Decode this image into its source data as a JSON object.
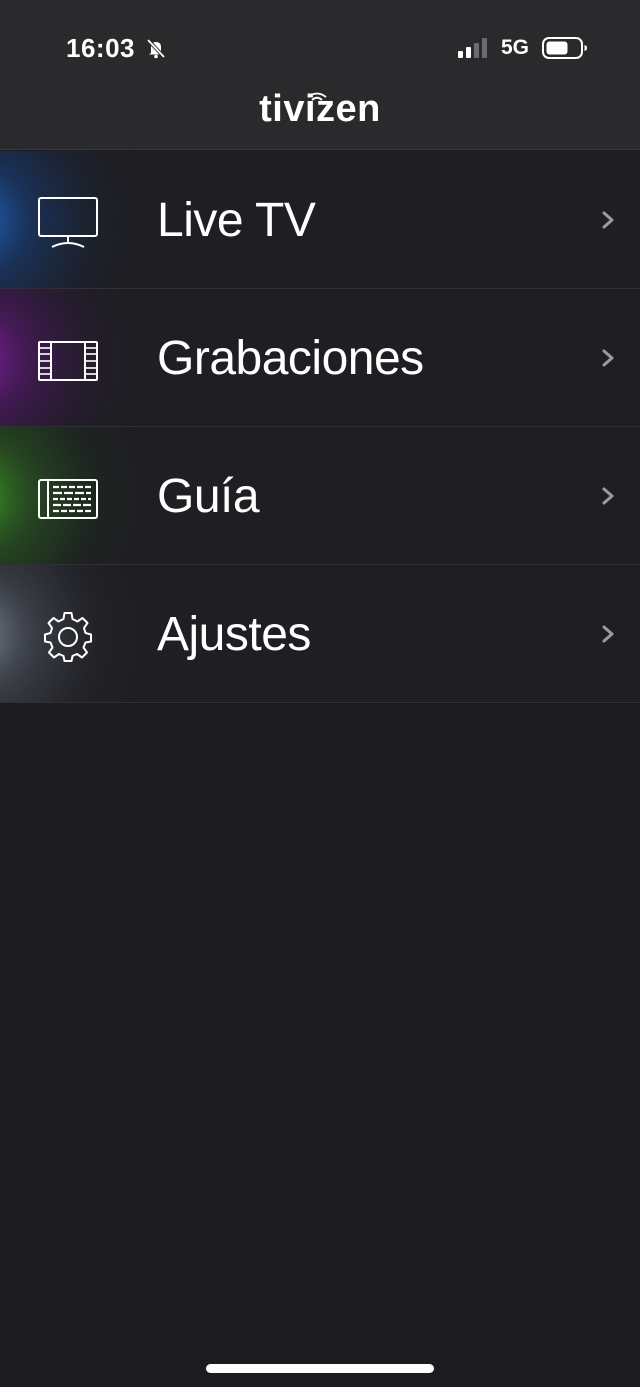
{
  "status_bar": {
    "time": "16:03",
    "network": "5G",
    "icons": [
      "bell-slash-icon",
      "signal-icon",
      "battery-icon"
    ]
  },
  "header": {
    "logo": "tivizen"
  },
  "menu": {
    "items": [
      {
        "label": "Live TV",
        "icon": "tv-icon",
        "glow_color": "#1a6fd6"
      },
      {
        "label": "Grabaciones",
        "icon": "film-icon",
        "glow_color": "#8a1fb0"
      },
      {
        "label": "Guía",
        "icon": "guide-icon",
        "glow_color": "#3fa32a"
      },
      {
        "label": "Ajustes",
        "icon": "gear-icon",
        "glow_color": "#9aa3b0"
      }
    ]
  },
  "colors": {
    "background": "#1c1c20",
    "header_background": "#2a2a2d",
    "row_background": "#1f1f23",
    "text": "#ffffff",
    "chevron": "#9a9aa0"
  }
}
